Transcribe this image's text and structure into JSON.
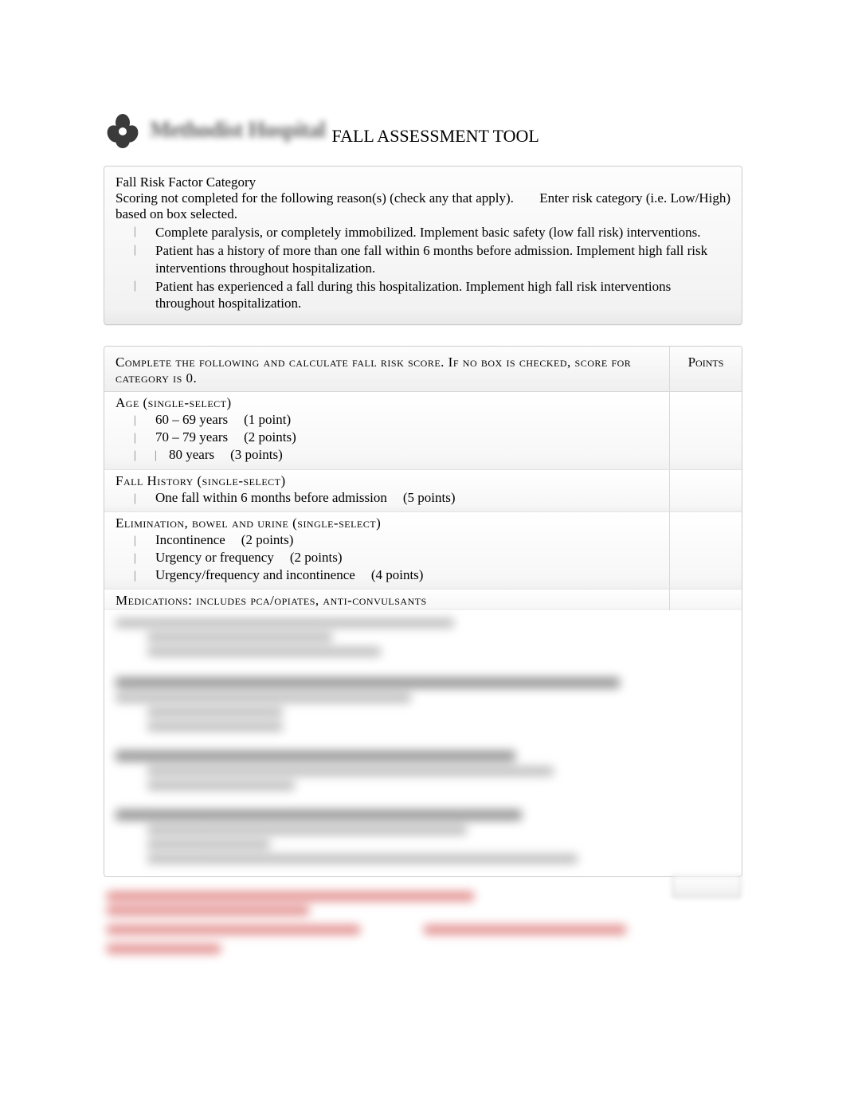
{
  "header": {
    "logo_text": "Methodist Hospital",
    "title": "FALL ASSESSMENT TOOL"
  },
  "top_panel": {
    "title": "Fall Risk Factor Category",
    "subtitle_left": "Scoring not completed for the following reason(s) (check any that apply).",
    "subtitle_right": "Enter risk category (i.e. Low/High)",
    "based_on": "based on box selected.",
    "reasons": [
      "Complete paralysis, or completely immobilized. Implement basic safety (low fall risk) interventions.",
      "Patient has a history of more than one fall within 6 months before admission. Implement high fall risk interventions throughout hospitalization.",
      "Patient has experienced a fall during this hospitalization. Implement high fall risk interventions throughout hospitalization."
    ]
  },
  "score_panel": {
    "instruction": "Complete the following and calculate fall risk score. If no box is checked, score for category is 0.",
    "points_header": "Points",
    "sections": {
      "age": {
        "title": "Age (single-select)",
        "options": [
          {
            "label": "60 – 69 years",
            "points": "(1 point)"
          },
          {
            "label": "70 – 79 years",
            "points": "(2 points)"
          },
          {
            "label": "80 years",
            "points": "(3 points)",
            "prefix_check": true
          }
        ]
      },
      "fall_history": {
        "title": "Fall History (single-select)",
        "options": [
          {
            "label": "One fall within 6 months before admission",
            "points": "(5 points)"
          }
        ]
      },
      "elimination": {
        "title": "Elimination, bowel and urine (single-select)",
        "options": [
          {
            "label": "Incontinence",
            "points": "(2 points)"
          },
          {
            "label": "Urgency or frequency",
            "points": "(2 points)"
          },
          {
            "label": "Urgency/frequency and incontinence",
            "points": "(4 points)"
          }
        ]
      },
      "medications": {
        "title": "Medications: includes pca/opiates, anti-convulsants"
      }
    }
  }
}
